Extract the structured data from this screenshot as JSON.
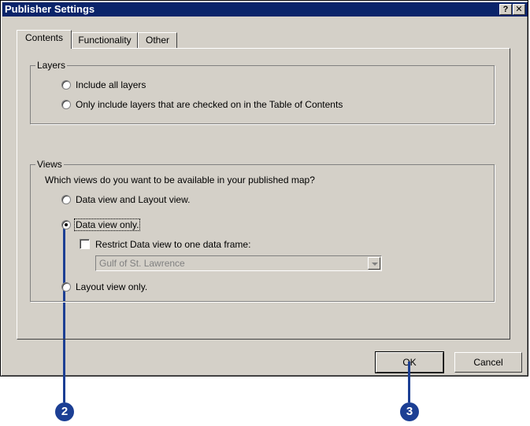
{
  "window": {
    "title": "Publisher Settings",
    "help_label": "?",
    "close_label": "✕"
  },
  "tabs": [
    {
      "label": "Contents",
      "active": true
    },
    {
      "label": "Functionality",
      "active": false
    },
    {
      "label": "Other",
      "active": false
    }
  ],
  "layers": {
    "legend": "Layers",
    "options": [
      {
        "label": "Include all layers",
        "checked": false
      },
      {
        "label": "Only include layers that are checked on in the Table of Contents",
        "checked": false
      }
    ]
  },
  "views": {
    "legend": "Views",
    "question": "Which views do you want to be available in your published map?",
    "options": [
      {
        "label": "Data view and Layout view.",
        "checked": false
      },
      {
        "label": "Data view only.",
        "checked": true
      },
      {
        "label": "Layout view only.",
        "checked": false
      }
    ],
    "restrict_label": "Restrict Data view to one data frame:",
    "restrict_checked": false,
    "data_frame_value": "Gulf of St. Lawrence"
  },
  "buttons": {
    "ok": "OK",
    "cancel": "Cancel"
  },
  "callouts": [
    "2",
    "3"
  ]
}
